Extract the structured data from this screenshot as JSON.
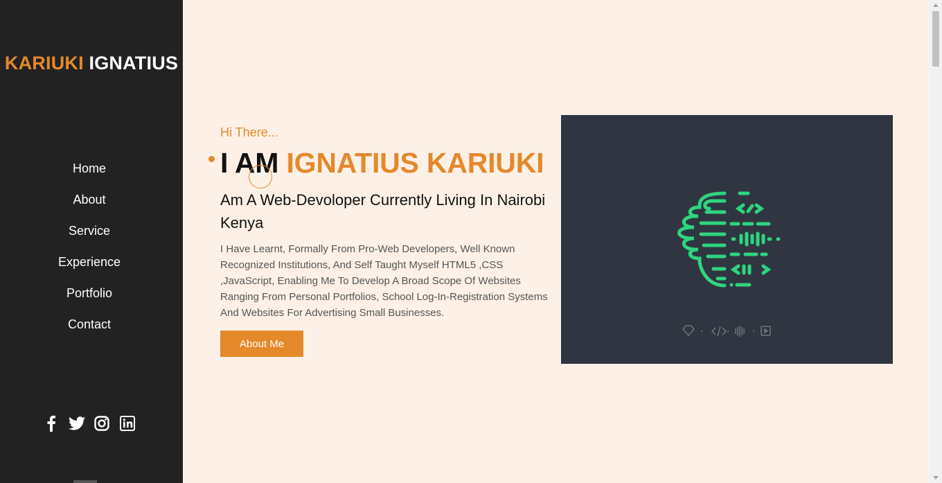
{
  "sidebar": {
    "logo_first": "KARIUKI",
    "logo_last": "IGNATIUS",
    "nav": [
      "Home",
      "About",
      "Service",
      "Experience",
      "Portfolio",
      "Contact"
    ],
    "social_icons": [
      "facebook-icon",
      "twitter-icon",
      "instagram-icon",
      "linkedin-icon"
    ]
  },
  "hero": {
    "greeting": "Hi There...",
    "headline_prefix": "I AM",
    "headline_name": "IGNATIUS KARIUKI",
    "subheading": "Am A Web-Devoloper Currently Living In Nairobi Kenya",
    "description": "I Have Learnt, Formally From Pro-Web Developers, Well Known Recognized Institutions, And Self Taught Myself HTML5 ,CSS ,JavaScript, Enabling Me To Develop A Broad Scope Of Websites Ranging From Personal Portfolios, School Log-In-Registration Systems And Websites For Advertising Small Businesses.",
    "button_label": "About Me",
    "image_icons": [
      "diamond-icon",
      "code-icon",
      "soundwave-icon",
      "play-icon"
    ]
  },
  "colors": {
    "accent": "#e5892b",
    "sidebar_bg": "#222222",
    "page_bg": "#fdf1e7",
    "image_bg": "#2f3641",
    "logo_green": "#2fd47f"
  }
}
